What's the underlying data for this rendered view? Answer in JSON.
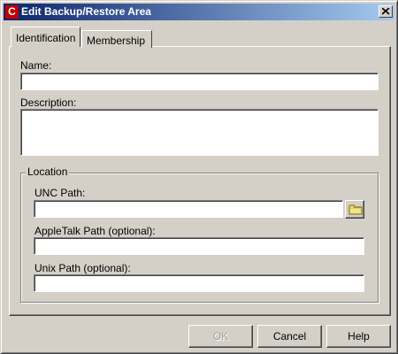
{
  "window": {
    "title": "Edit Backup/Restore Area",
    "app_icon_letter": "C",
    "close_glyph": "x"
  },
  "tabs": [
    {
      "label": "Identification",
      "active": true
    },
    {
      "label": "Membership",
      "active": false
    }
  ],
  "form": {
    "name_label": "Name:",
    "name_value": "",
    "description_label": "Description:",
    "description_value": "",
    "location": {
      "group_label": "Location",
      "unc_label": "UNC Path:",
      "unc_value": "",
      "browse_icon": "folder-icon",
      "appletalk_label": "AppleTalk Path (optional):",
      "appletalk_value": "",
      "unix_label": "Unix Path (optional):",
      "unix_value": ""
    }
  },
  "buttons": {
    "ok": "OK",
    "ok_enabled": false,
    "cancel": "Cancel",
    "help": "Help"
  },
  "colors": {
    "titlebar_start": "#0a246a",
    "titlebar_end": "#a6caf0",
    "dialog_face": "#d4d0c8",
    "app_icon": "#c00000"
  }
}
